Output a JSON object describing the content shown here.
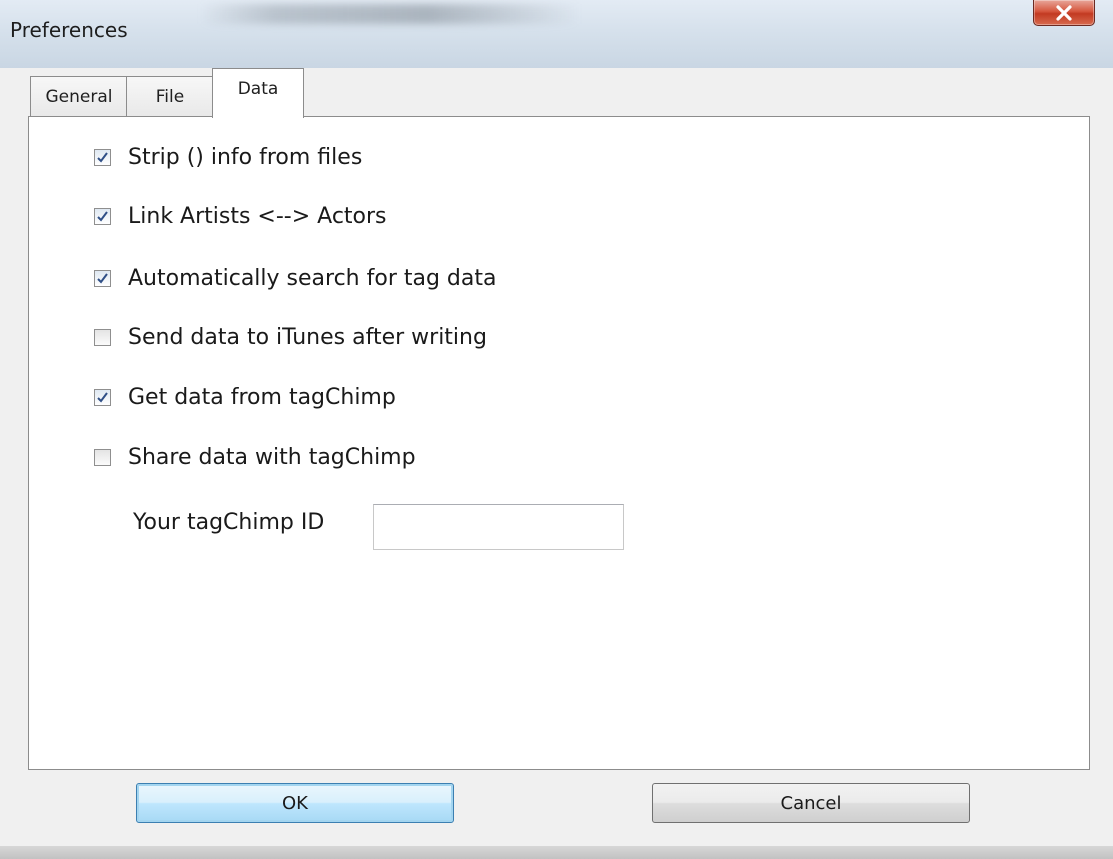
{
  "window": {
    "title": "Preferences"
  },
  "tabs": [
    {
      "label": "General"
    },
    {
      "label": "File"
    },
    {
      "label": "Data",
      "selected": true
    }
  ],
  "options": [
    {
      "label": "Strip () info from files",
      "checked": true
    },
    {
      "label": "Link Artists <--> Actors",
      "checked": true
    },
    {
      "label": "Automatically search for tag data",
      "checked": true
    },
    {
      "label": "Send data to iTunes after writing",
      "checked": false
    },
    {
      "label": "Get data from tagChimp",
      "checked": true
    },
    {
      "label": "Share data with tagChimp",
      "checked": false
    }
  ],
  "tagchimp_id": {
    "label": "Your tagChimp ID",
    "value": ""
  },
  "buttons": {
    "ok_label": "OK",
    "cancel_label": "Cancel"
  },
  "colors": {
    "close_button": "#c23a22",
    "default_button_border": "#3c7fb1",
    "check_mark": "#2f4f87"
  },
  "icons": {
    "close": "close-icon",
    "check": "checkmark-icon"
  }
}
